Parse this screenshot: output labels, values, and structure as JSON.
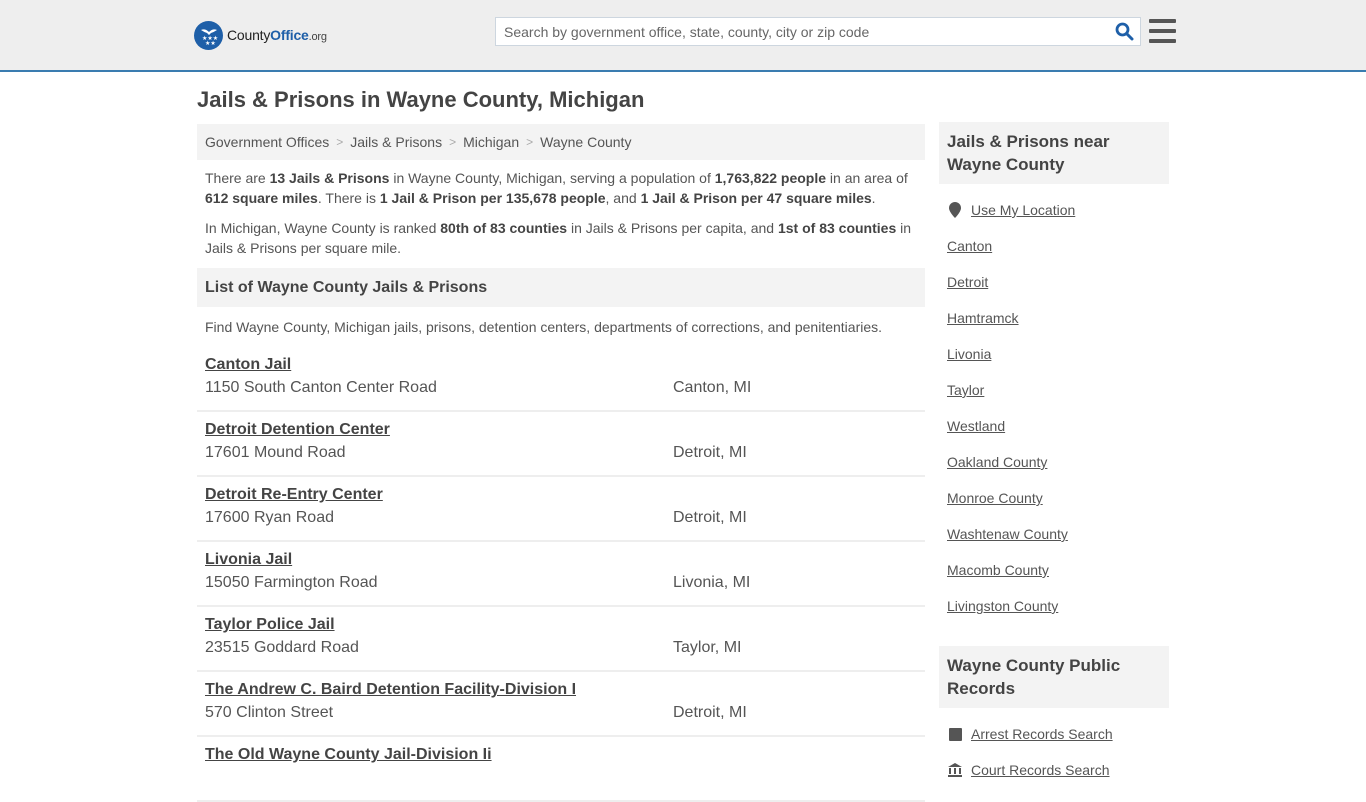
{
  "header": {
    "logo": {
      "brand_prefix": "County",
      "brand_main": "Office",
      "brand_suffix": ".org",
      "icon": "eagle-stars-icon"
    },
    "search": {
      "placeholder": "Search by government office, state, county, city or zip code",
      "value": "",
      "icon": "search-icon"
    },
    "menu_icon": "hamburger-menu-icon",
    "accent_color": "#3a7cb0",
    "brand_color": "#1e5fa8"
  },
  "page": {
    "title": "Jails & Prisons in Wayne County, Michigan"
  },
  "breadcrumb": [
    {
      "label": "Government Offices"
    },
    {
      "label": "Jails & Prisons"
    },
    {
      "label": "Michigan"
    },
    {
      "label": "Wayne County"
    }
  ],
  "intro": {
    "p1": {
      "t1": "There are ",
      "b1": "13 Jails & Prisons",
      "t2": " in Wayne County, Michigan, serving a population of ",
      "b2": "1,763,822 people",
      "t3": " in an area of ",
      "b3": "612 square miles",
      "t4": ". There is ",
      "b4": "1 Jail & Prison per 135,678 people",
      "t5": ", and ",
      "b5": "1 Jail & Prison per 47 square miles",
      "t6": "."
    },
    "p2": {
      "t1": "In Michigan, Wayne County is ranked ",
      "b1": "80th of 83 counties",
      "t2": " in Jails & Prisons per capita, and ",
      "b2": "1st of 83 counties",
      "t3": " in Jails & Prisons per square mile."
    }
  },
  "list_section": {
    "heading": "List of Wayne County Jails & Prisons",
    "description": "Find Wayne County, Michigan jails, prisons, detention centers, departments of corrections, and penitentiaries.",
    "items": [
      {
        "name": "Canton Jail",
        "address": "1150 South Canton Center Road",
        "city": "Canton, MI"
      },
      {
        "name": "Detroit Detention Center",
        "address": "17601 Mound Road",
        "city": "Detroit, MI"
      },
      {
        "name": "Detroit Re-Entry Center",
        "address": "17600 Ryan Road",
        "city": "Detroit, MI"
      },
      {
        "name": "Livonia Jail",
        "address": "15050 Farmington Road",
        "city": "Livonia, MI"
      },
      {
        "name": "Taylor Police Jail",
        "address": "23515 Goddard Road",
        "city": "Taylor, MI"
      },
      {
        "name": "The Andrew C. Baird Detention Facility-Division I",
        "address": "570 Clinton Street",
        "city": "Detroit, MI"
      },
      {
        "name": "The Old Wayne County Jail-Division Ii",
        "address": "",
        "city": ""
      }
    ]
  },
  "sidebar": {
    "nearby": {
      "heading": "Jails & Prisons near Wayne County",
      "use_location": {
        "label": "Use My Location",
        "icon": "map-pin-icon"
      },
      "links": [
        {
          "label": "Canton"
        },
        {
          "label": "Detroit"
        },
        {
          "label": "Hamtramck"
        },
        {
          "label": "Livonia"
        },
        {
          "label": "Taylor"
        },
        {
          "label": "Westland"
        },
        {
          "label": "Oakland County"
        },
        {
          "label": "Monroe County"
        },
        {
          "label": "Washtenaw County"
        },
        {
          "label": "Macomb County"
        },
        {
          "label": "Livingston County"
        }
      ]
    },
    "records": {
      "heading": "Wayne County Public Records",
      "links": [
        {
          "label": "Arrest Records Search",
          "icon": "square-icon"
        },
        {
          "label": "Court Records Search",
          "icon": "courthouse-icon"
        }
      ]
    }
  }
}
